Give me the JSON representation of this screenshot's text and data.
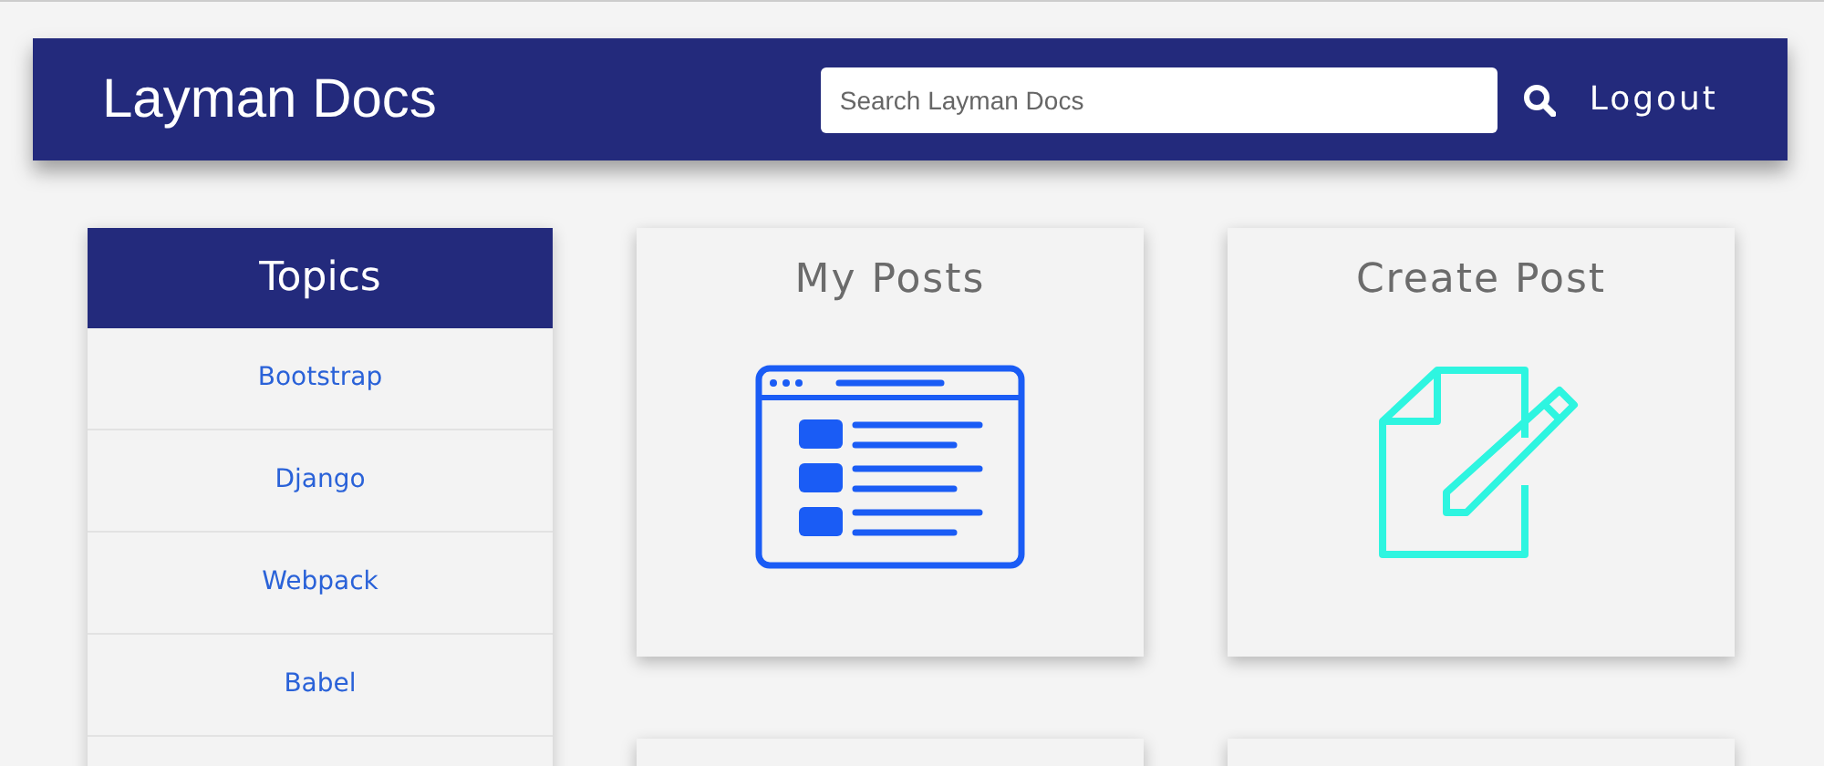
{
  "header": {
    "title": "Layman Docs",
    "search": {
      "placeholder": "Search Layman Docs"
    },
    "logout": "Logout"
  },
  "sidebar": {
    "title": "Topics",
    "items": [
      "Bootstrap",
      "Django",
      "Webpack",
      "Babel"
    ]
  },
  "cards": [
    {
      "title": "My Posts",
      "kind": "posts"
    },
    {
      "title": "Create Post",
      "kind": "create"
    }
  ]
}
